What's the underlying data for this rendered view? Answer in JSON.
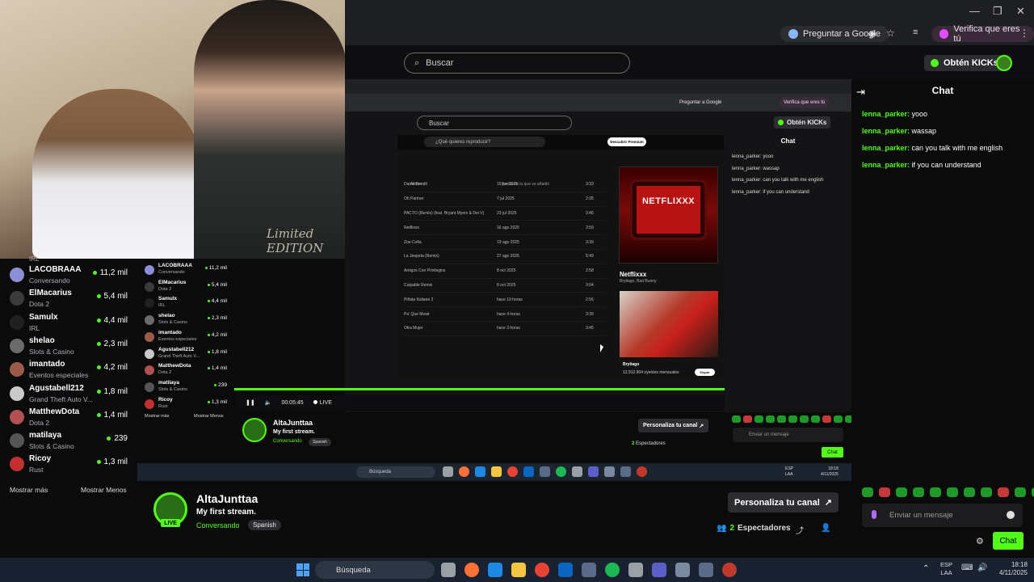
{
  "browser": {
    "ask_google": "Preguntar a Google",
    "verify": "Verifica que eres tú",
    "search_placeholder": "Buscar"
  },
  "header": {
    "kick_button": "Obtén KICKs"
  },
  "webcam": {
    "shirt_text": "Limited EDITION"
  },
  "nested_browser": {
    "ask_google": "Preguntar a Google",
    "verify": "Verifica que eres tú",
    "search_placeholder": "Buscar",
    "kick_button": "Obtén KICKs"
  },
  "spotify": {
    "search_placeholder": "¿Qué quieres reproducir?",
    "premium_button": "Descubrir Premium",
    "columns": [
      "Álbum",
      "Fecha en la que se añadió"
    ],
    "rows": [
      [
        "Dame Bendit",
        "15 jun 2025",
        "3:33"
      ],
      [
        "Oh Partner",
        "7 jul 2025",
        "2:35"
      ],
      [
        "PACTO (Remix) (feat. Bryant Myers & Dei V)",
        "23 jul 2025",
        "3:46"
      ],
      [
        "Netflixxx",
        "16 ago 2025",
        "3:59"
      ],
      [
        "Zoe Colta",
        "19 ago 2025",
        "3:39"
      ],
      [
        "La Jeepeta (Remix)",
        "27 ago 2025",
        "5:49"
      ],
      [
        "Amigos Con Privilegios",
        "8 oct 2025",
        "2:58"
      ],
      [
        "Culpable Remix",
        "8 oct 2025",
        "3:04"
      ],
      [
        "Piñata Kaliane 2",
        "hace 19 horas",
        "2:56"
      ],
      [
        "Pa' Que Mostr",
        "hace 4 horas",
        "3:39"
      ],
      [
        "Otra Mujer",
        "hace 3 horas",
        "3:45"
      ]
    ],
    "album_title": "NETFLIXXX",
    "track_title": "Netflixxx",
    "track_artists": "Brytiago, Bad Bunny",
    "artist_name": "Brytiago",
    "artist_listeners": "12.912.904 oyentes mensuales",
    "follow_button": "Seguir"
  },
  "nested_player": {
    "time": "00:05:45",
    "live_label": "LIVE"
  },
  "sidebar": {
    "items": [
      {
        "name": "LACOBRAAA",
        "category": "Conversando",
        "viewers": "11,2 mil",
        "color": "#8a8fd6"
      },
      {
        "name": "ElMacarius",
        "category": "Dota 2",
        "viewers": "5,4 mil",
        "color": "#3a3a3a"
      },
      {
        "name": "Samulx",
        "category": "IRL",
        "viewers": "4,4 mil",
        "color": "#202020"
      },
      {
        "name": "shelao",
        "category": "Slots & Casino",
        "viewers": "2,3 mil",
        "color": "#6b6b6b"
      },
      {
        "name": "imantado",
        "category": "Eventos especiales",
        "viewers": "4,2 mil",
        "color": "#9b5b4b"
      },
      {
        "name": "Agustabell212",
        "category": "Grand Theft Auto V...",
        "viewers": "1,8 mil",
        "color": "#c9c9c9"
      },
      {
        "name": "MatthewDota",
        "category": "Dota 2",
        "viewers": "1,4 mil",
        "color": "#b05050"
      },
      {
        "name": "matilaya",
        "category": "Slots & Casino",
        "viewers": "239",
        "color": "#555"
      },
      {
        "name": "Ricoy",
        "category": "Rust",
        "viewers": "1,3 mil",
        "color": "#c23030"
      }
    ],
    "partial_category": "IRL",
    "show_more": "Mostrar más",
    "show_less": "Mostrar Menos"
  },
  "stream": {
    "channel": "AltaJunttaa",
    "title": "My first stream.",
    "category": "Conversando",
    "language": "Spanish",
    "live_badge": "LIVE",
    "customize": "Personaliza tu canal",
    "viewer_count": "2",
    "viewers_label": "Espectadores"
  },
  "chat": {
    "title": "Chat",
    "messages": [
      {
        "user": "lenna_parker:",
        "text": "yooo"
      },
      {
        "user": "lenna_parker:",
        "text": "wassap"
      },
      {
        "user": "lenna_parker:",
        "text": "can you talk with me english"
      },
      {
        "user": "lenna_parker:",
        "text": "if you can understand"
      }
    ],
    "input_placeholder": "Enviar un mensaje",
    "send_button": "Chat"
  },
  "taskbar": {
    "search": "Búsqueda",
    "lang_top": "ESP",
    "lang_bottom": "LAA",
    "time": "18:18",
    "date": "4/11/2025"
  },
  "nested_taskbar": {
    "search": "Búsqueda",
    "lang_top": "ESP",
    "lang_bottom": "LAA",
    "time": "18:18",
    "date": "4/11/2025"
  },
  "colors": {
    "kick_green": "#53fc18",
    "background": "#0b0b0c",
    "panel": "#2b2d31"
  }
}
